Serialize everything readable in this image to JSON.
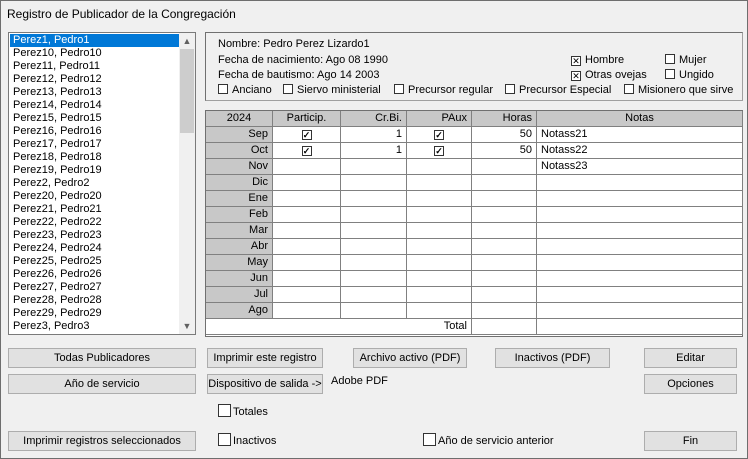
{
  "title": "Registro de Publicador de la Congregación",
  "list": [
    "Perez1, Pedro1",
    "Perez10, Pedro10",
    "Perez11, Pedro11",
    "Perez12, Pedro12",
    "Perez13, Pedro13",
    "Perez14, Pedro14",
    "Perez15, Pedro15",
    "Perez16, Pedro16",
    "Perez17, Pedro17",
    "Perez18, Pedro18",
    "Perez19, Pedro19",
    "Perez2, Pedro2",
    "Perez20, Pedro20",
    "Perez21, Pedro21",
    "Perez22, Pedro22",
    "Perez23, Pedro23",
    "Perez24, Pedro24",
    "Perez25, Pedro25",
    "Perez26, Pedro26",
    "Perez27, Pedro27",
    "Perez28, Pedro28",
    "Perez29, Pedro29",
    "Perez3, Pedro3"
  ],
  "info": {
    "nombre": "Nombre:  Pedro Perez Lizardo1",
    "nacimiento": "Fecha de nacimiento:  Ago 08 1990",
    "bautismo": "Fecha de bautismo:  Ago 14 2003",
    "hombre": "Hombre",
    "mujer": "Mujer",
    "otras": "Otras ovejas",
    "ungido": "Ungido",
    "anciano": "Anciano",
    "siervo": "Siervo ministerial",
    "regular": "Precursor regular",
    "especial": "Precursor Especial",
    "misionero": "Misionero que sirve"
  },
  "table": {
    "headers": [
      "2024",
      "Particip.",
      "Cr.Bi.",
      "PAux",
      "Horas",
      "Notas"
    ],
    "rows": [
      {
        "m": "Sep",
        "p": true,
        "c": "1",
        "a": true,
        "h": "50",
        "n": "Notass21"
      },
      {
        "m": "Oct",
        "p": true,
        "c": "1",
        "a": true,
        "h": "50",
        "n": "Notass22"
      },
      {
        "m": "Nov",
        "p": false,
        "c": "",
        "a": false,
        "h": "",
        "n": "Notass23"
      },
      {
        "m": "Dic"
      },
      {
        "m": "Ene"
      },
      {
        "m": "Feb"
      },
      {
        "m": "Mar"
      },
      {
        "m": "Abr"
      },
      {
        "m": "May"
      },
      {
        "m": "Jun"
      },
      {
        "m": "Jul"
      },
      {
        "m": "Ago"
      }
    ],
    "total": "Total"
  },
  "buttons": {
    "todas": "Todas Publicadores",
    "imprimir": "Imprimir este registro",
    "archivo": "Archivo activo (PDF)",
    "inactivos_pdf": "Inactivos (PDF)",
    "editar": "Editar",
    "ano": "Año de servicio",
    "dispositivo": "Dispositivo de salida ->",
    "opciones": "Opciones",
    "imprimir_sel": "Imprimir registros seleccionados",
    "fin": "Fin"
  },
  "device": "Adobe PDF",
  "checks": {
    "totales": "Totales",
    "inactivos": "Inactivos",
    "ano_anterior": "Año de servicio anterior"
  }
}
